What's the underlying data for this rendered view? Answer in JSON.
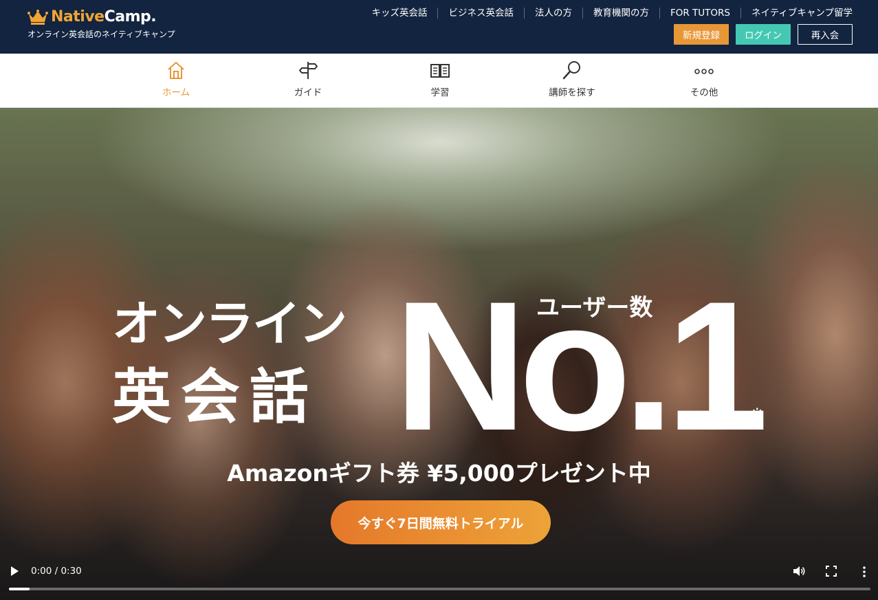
{
  "header": {
    "logo_native": "Native",
    "logo_camp": "Camp.",
    "tagline": "オンライン英会話のネイティブキャンプ",
    "nav": [
      {
        "label": "キッズ英会話"
      },
      {
        "label": "ビジネス英会話"
      },
      {
        "label": "法人の方"
      },
      {
        "label": "教育機関の方"
      },
      {
        "label": "FOR TUTORS"
      },
      {
        "label": "ネイティブキャンプ留学"
      }
    ],
    "register_label": "新規登録",
    "login_label": "ログイン",
    "rejoin_label": "再入会"
  },
  "subnav": {
    "items": [
      {
        "label": "ホーム",
        "icon": "home-icon",
        "active": true
      },
      {
        "label": "ガイド",
        "icon": "signpost-icon",
        "active": false
      },
      {
        "label": "学習",
        "icon": "book-icon",
        "active": false
      },
      {
        "label": "講師を探す",
        "icon": "search-icon",
        "active": false
      },
      {
        "label": "その他",
        "icon": "more-dots-icon",
        "active": false
      }
    ]
  },
  "hero": {
    "line1": "オンライン",
    "line2": "英会話",
    "users_label": "ユーザー数",
    "no1": "No.1",
    "footnote_mark": "※",
    "gift": "Amazonギフト券 ¥5,000プレゼント中",
    "cta_label": "今すぐ7日間無料トライアル"
  },
  "video": {
    "time": "0:00 / 0:30",
    "progress": 0.024
  },
  "colors": {
    "header_bg": "#12243f",
    "accent_orange": "#e89737",
    "login_teal": "#45c8b3"
  }
}
